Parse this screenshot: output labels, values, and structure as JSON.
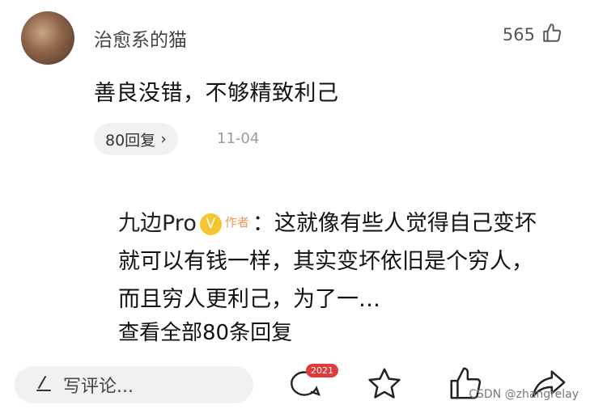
{
  "comment": {
    "username": "治愈系的猫",
    "likes": "565",
    "text": "善良没错，不够精致利己",
    "reply_button": "80回复",
    "reply_chevron": "›",
    "date": "11-04"
  },
  "sub_reply": {
    "author": "九边Pro",
    "verified_mark": "V",
    "author_tag": "作者",
    "text": "：这就像有些人觉得自己变坏就可以有钱一样，其实变坏依旧是个穷人，而且穷人更利己，为了一…",
    "view_all": "查看全部80条回复"
  },
  "bottom_bar": {
    "write_placeholder": "写评论...",
    "comment_count_badge": "2021",
    "icons": [
      "comment-icon",
      "star-icon",
      "thumb-up-icon",
      "share-icon"
    ]
  },
  "watermark": "CSDN @zhangrelay"
}
